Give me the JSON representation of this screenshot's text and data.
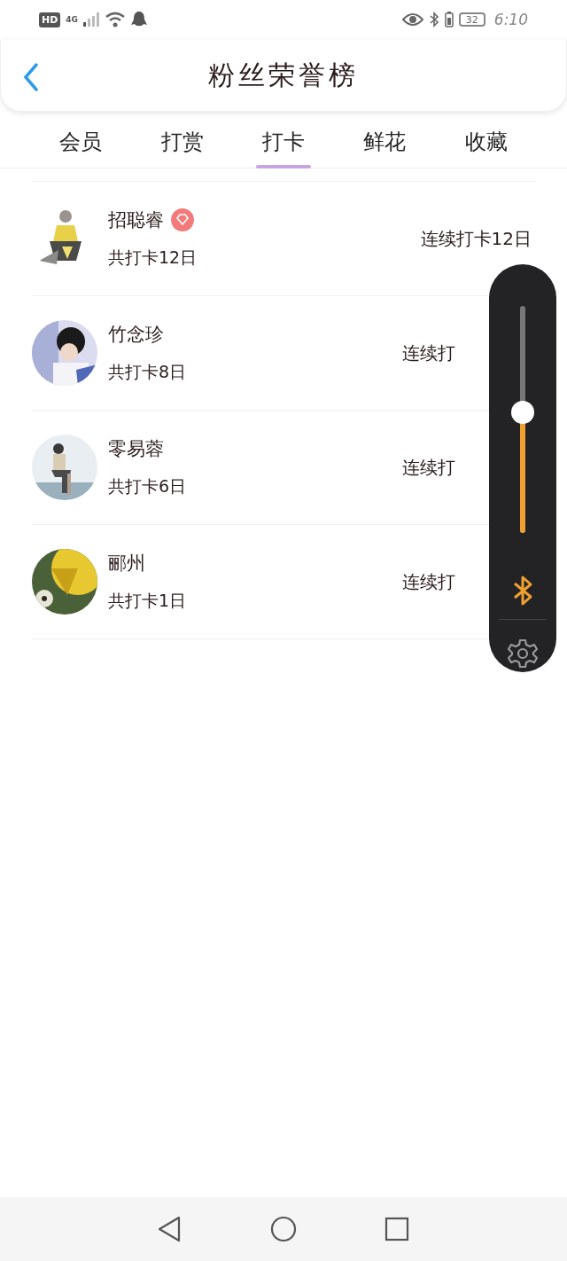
{
  "status_bar": {
    "badge": "HD",
    "network": "4G",
    "battery": "32",
    "time": "6:10"
  },
  "header": {
    "title": "粉丝荣誉榜"
  },
  "tabs": [
    {
      "label": "会员",
      "selected": false
    },
    {
      "label": "打赏",
      "selected": false
    },
    {
      "label": "打卡",
      "selected": true
    },
    {
      "label": "鲜花",
      "selected": false
    },
    {
      "label": "收藏",
      "selected": false
    }
  ],
  "rows": [
    {
      "name": "招聪睿",
      "vip": true,
      "total": "共打卡12日",
      "streak": "连续打卡12日"
    },
    {
      "name": "竹念珍",
      "vip": false,
      "total": "共打卡8日",
      "streak": "连续打"
    },
    {
      "name": "零易蓉",
      "vip": false,
      "total": "共打卡6日",
      "streak": "连续打"
    },
    {
      "name": "郦州",
      "vip": false,
      "total": "共打卡1日",
      "streak": "连续打"
    }
  ],
  "volume_panel": {
    "level": 0.53
  }
}
